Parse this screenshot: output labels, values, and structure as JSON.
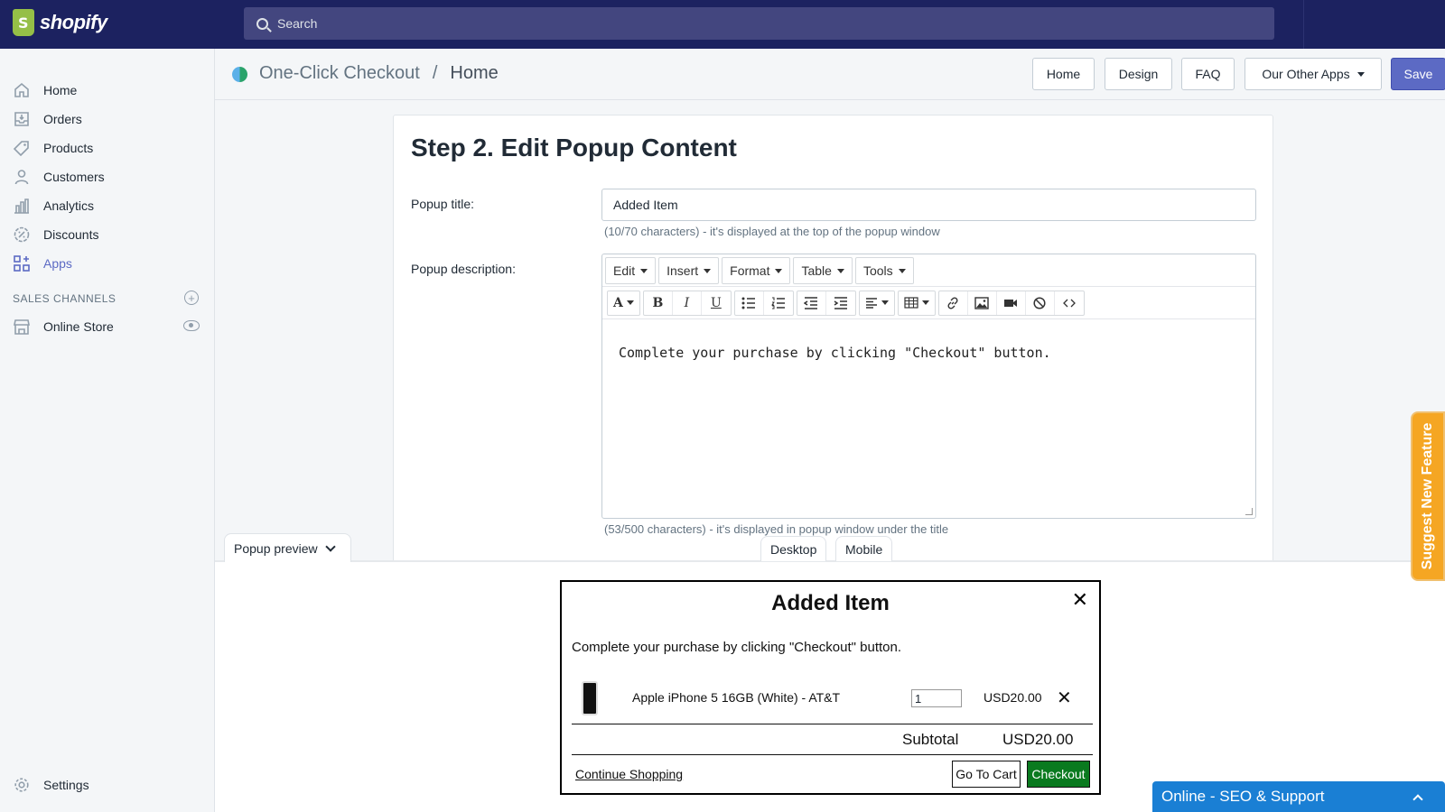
{
  "topbar": {
    "brand": "shopify",
    "search_placeholder": "Search"
  },
  "sidebar": {
    "items": [
      {
        "label": "Home",
        "icon": "home-icon"
      },
      {
        "label": "Orders",
        "icon": "orders-icon"
      },
      {
        "label": "Products",
        "icon": "tag-icon"
      },
      {
        "label": "Customers",
        "icon": "person-icon"
      },
      {
        "label": "Analytics",
        "icon": "bar-chart-icon"
      },
      {
        "label": "Discounts",
        "icon": "discount-icon"
      },
      {
        "label": "Apps",
        "icon": "apps-icon"
      }
    ],
    "sales_channels_title": "SALES CHANNELS",
    "online_store": "Online Store",
    "settings": "Settings"
  },
  "header": {
    "app_name": "One-Click Checkout",
    "separator": "/",
    "current_page": "Home",
    "buttons": {
      "home": "Home",
      "design": "Design",
      "faq": "FAQ",
      "other_apps": "Our Other Apps",
      "save": "Save"
    }
  },
  "card": {
    "title": "Step 2. Edit Popup Content",
    "popup_title_label": "Popup title:",
    "popup_title_value": "Added Item",
    "popup_title_help": "(10/70 characters) - it's displayed at the top of the popup window",
    "popup_desc_label": "Popup description:",
    "editor_menu": [
      "Edit",
      "Insert",
      "Format",
      "Table",
      "Tools"
    ],
    "editor_content": "Complete your purchase by clicking \"Checkout\" button.",
    "popup_desc_help": "(53/500 characters) - it's displayed in popup window under the title"
  },
  "preview": {
    "toggle_label": "Popup preview",
    "tabs": {
      "desktop": "Desktop",
      "mobile": "Mobile"
    },
    "popup": {
      "title": "Added Item",
      "close": "✕",
      "description": "Complete your purchase by clicking \"Checkout\" button.",
      "product_name": "Apple iPhone 5 16GB (White) - AT&T",
      "quantity": "1",
      "price": "USD20.00",
      "remove": "✕",
      "subtotal_label": "Subtotal",
      "subtotal_value": "USD20.00",
      "continue_shopping": "Continue Shopping",
      "go_to_cart": "Go To Cart",
      "checkout": "Checkout"
    }
  },
  "floating": {
    "suggest_feature": "Suggest New Feature",
    "support": "Online - SEO & Support"
  },
  "colors": {
    "topbar": "#1c2260",
    "accent": "#5c6ac4",
    "checkout_green": "#0a7a1f",
    "suggest_orange": "#f5a623",
    "support_blue": "#1a7fd4"
  }
}
